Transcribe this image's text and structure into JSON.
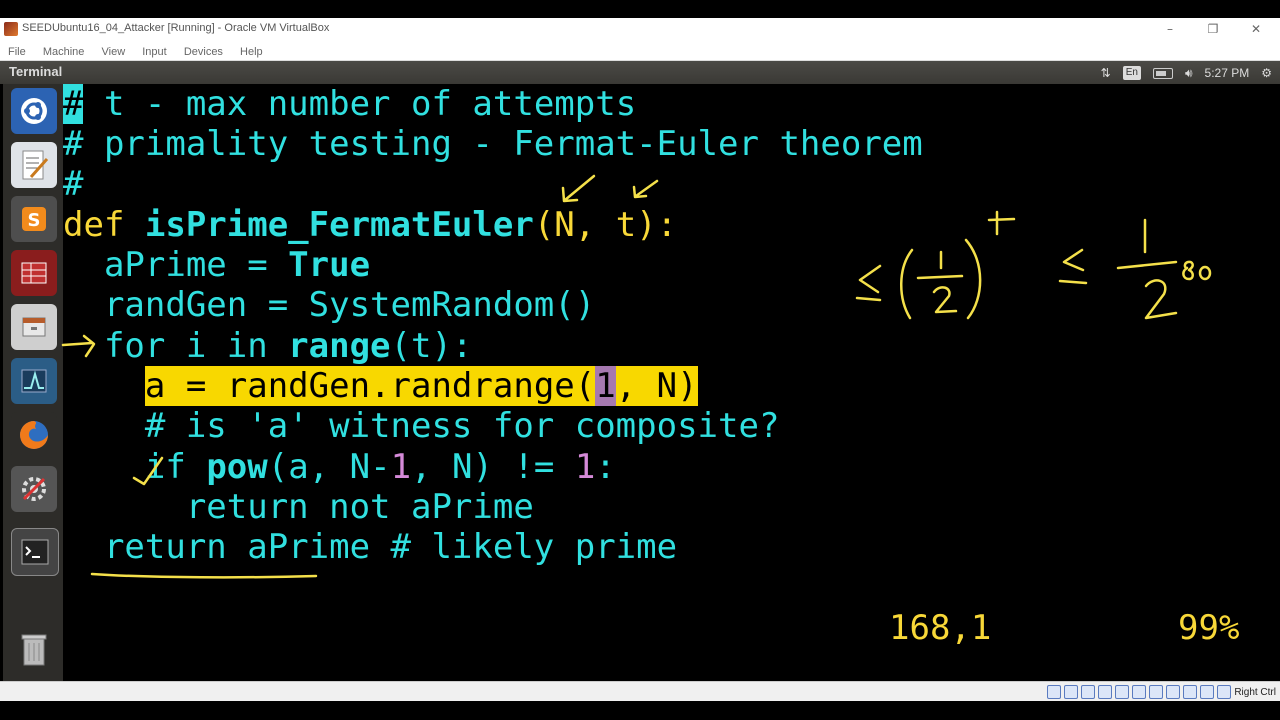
{
  "window": {
    "title": "SEEDUbuntu16_04_Attacker [Running] - Oracle VM VirtualBox",
    "minimize": "–",
    "restore": "❐",
    "close": "✕"
  },
  "menubar": [
    "File",
    "Machine",
    "View",
    "Input",
    "Devices",
    "Help"
  ],
  "panel": {
    "title": "Terminal",
    "keyboard": "En",
    "time": "5:27 PM"
  },
  "launcher": {
    "icons": [
      "ubuntu-dash-icon",
      "text-editor-icon",
      "sublime-text-icon",
      "wireshark-icon",
      "files-icon",
      "system-monitor-icon",
      "firefox-icon",
      "settings-icon",
      "terminal-icon",
      "trash-icon"
    ]
  },
  "code": {
    "line1_cursor": "#",
    "line1_rest": " t - max number of attempts",
    "line2": "# primality testing - Fermat-Euler theorem",
    "line3": "#",
    "line4_def": "def ",
    "line4_name": "isPrime_FermatEuler",
    "line4_params": "(N, t):",
    "line5_a": "  aPrime = ",
    "line5_b": "True",
    "line6": "  randGen = SystemRandom()",
    "line7_a": "  for i in ",
    "line7_b": "range",
    "line7_c": "(t):",
    "line8_a": "a = randGen.randrange(",
    "line8_b": "1",
    "line8_c": ", N)",
    "line9": "    # is 'a' witness for composite?",
    "line10_a": "if ",
    "line10_b": "pow",
    "line10_c": "(a, N-",
    "line10_d": "1",
    "line10_e": ", N) != ",
    "line10_f": "1",
    "line10_g": ":",
    "line11": "      return not aPrime",
    "line12": "  return aPrime # likely prime"
  },
  "vim_status": {
    "position": "168,1",
    "percent": "99%"
  },
  "annotation": {
    "t": "t",
    "one": "1",
    "two": "2",
    "eighty": "80"
  },
  "statusbar": {
    "host_key": "Right Ctrl"
  },
  "colors": {
    "code": "#31e0e0",
    "highlight": "#f8d800",
    "ink": "#f4e04a",
    "number": "#d58ad8"
  }
}
